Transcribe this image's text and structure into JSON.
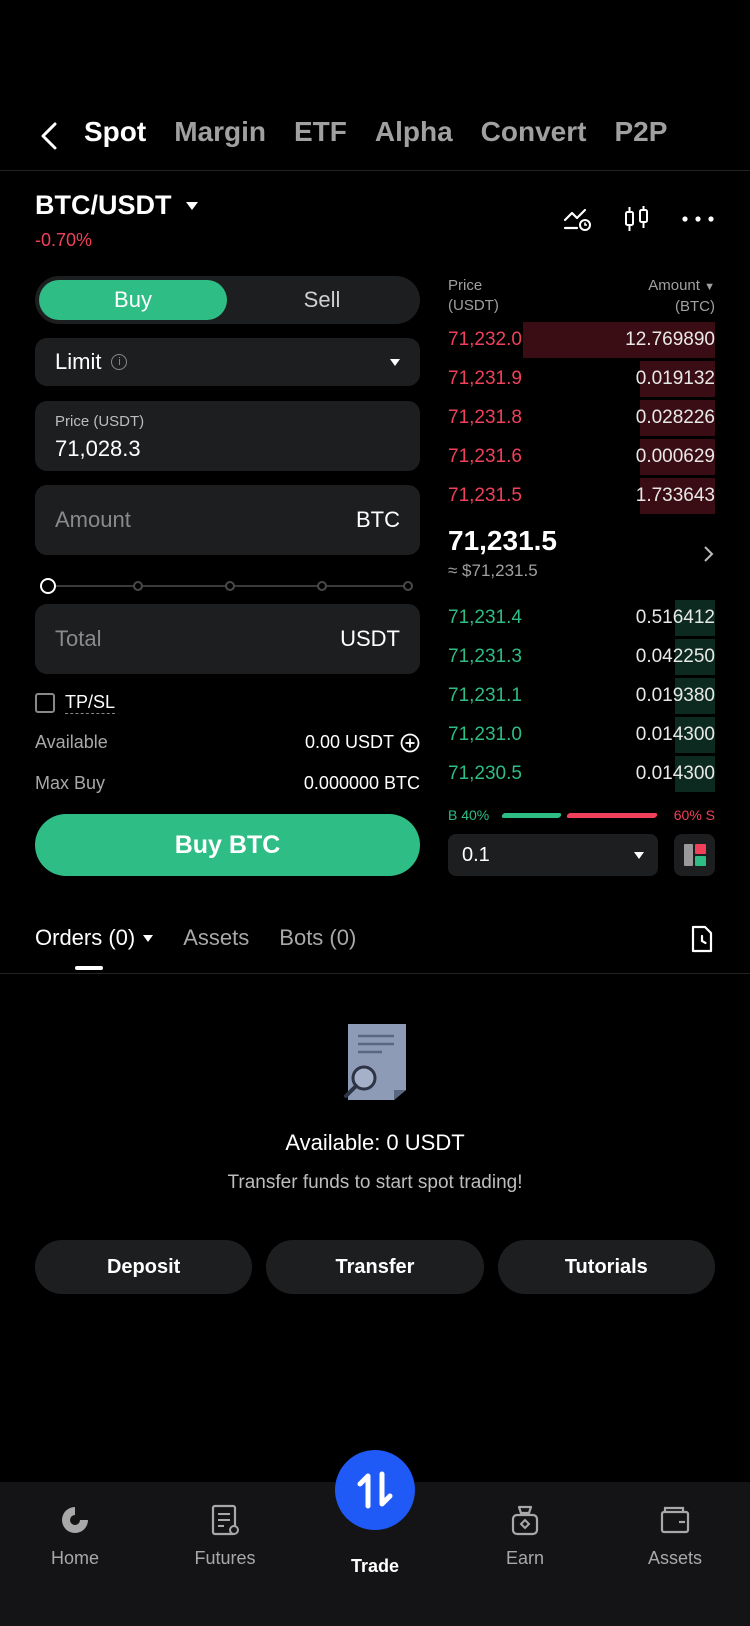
{
  "top_tabs": [
    "Spot",
    "Margin",
    "ETF",
    "Alpha",
    "Convert",
    "P2P"
  ],
  "pair": {
    "symbol": "BTC/USDT",
    "change": "-0.70%"
  },
  "order_form": {
    "buy_label": "Buy",
    "sell_label": "Sell",
    "order_type": "Limit",
    "price_label": "Price (USDT)",
    "price_value": "71,028.3",
    "amount_placeholder": "Amount",
    "amount_unit": "BTC",
    "total_placeholder": "Total",
    "total_unit": "USDT",
    "tpsl_label": "TP/SL",
    "available_label": "Available",
    "available_value": "0.00 USDT",
    "max_buy_label": "Max Buy",
    "max_buy_value": "0.000000 BTC",
    "submit_label": "Buy BTC",
    "slider_percent": 0
  },
  "order_book": {
    "price_header": "Price",
    "price_unit": "(USDT)",
    "amount_header": "Amount",
    "amount_unit": "(BTC)",
    "asks": [
      {
        "price": "71,232.0",
        "amount": "12.769890",
        "depth": 0.72
      },
      {
        "price": "71,231.9",
        "amount": "0.019132",
        "depth": 0.28
      },
      {
        "price": "71,231.8",
        "amount": "0.028226",
        "depth": 0.28
      },
      {
        "price": "71,231.6",
        "amount": "0.000629",
        "depth": 0.28
      },
      {
        "price": "71,231.5",
        "amount": "1.733643",
        "depth": 0.28
      }
    ],
    "mid_price": "71,231.5",
    "mid_usd": "≈ $71,231.5",
    "bids": [
      {
        "price": "71,231.4",
        "amount": "0.516412",
        "depth": 0.15
      },
      {
        "price": "71,231.3",
        "amount": "0.042250",
        "depth": 0.15
      },
      {
        "price": "71,231.1",
        "amount": "0.019380",
        "depth": 0.15
      },
      {
        "price": "71,231.0",
        "amount": "0.014300",
        "depth": 0.15
      },
      {
        "price": "71,230.5",
        "amount": "0.014300",
        "depth": 0.15
      }
    ],
    "buy_ratio": "B 40%",
    "sell_ratio": "60% S",
    "depth_step": "0.1"
  },
  "orders_tabs": {
    "orders": "Orders (0)",
    "assets": "Assets",
    "bots": "Bots (0)"
  },
  "empty_state": {
    "title": "Available: 0 USDT",
    "subtitle": "Transfer funds to start spot trading!"
  },
  "actions": [
    "Deposit",
    "Transfer",
    "Tutorials"
  ],
  "bottom_nav": [
    "Home",
    "Futures",
    "Trade",
    "Earn",
    "Assets"
  ],
  "colors": {
    "green": "#2ebd85",
    "red": "#f0405a",
    "blue": "#1f5af7"
  }
}
